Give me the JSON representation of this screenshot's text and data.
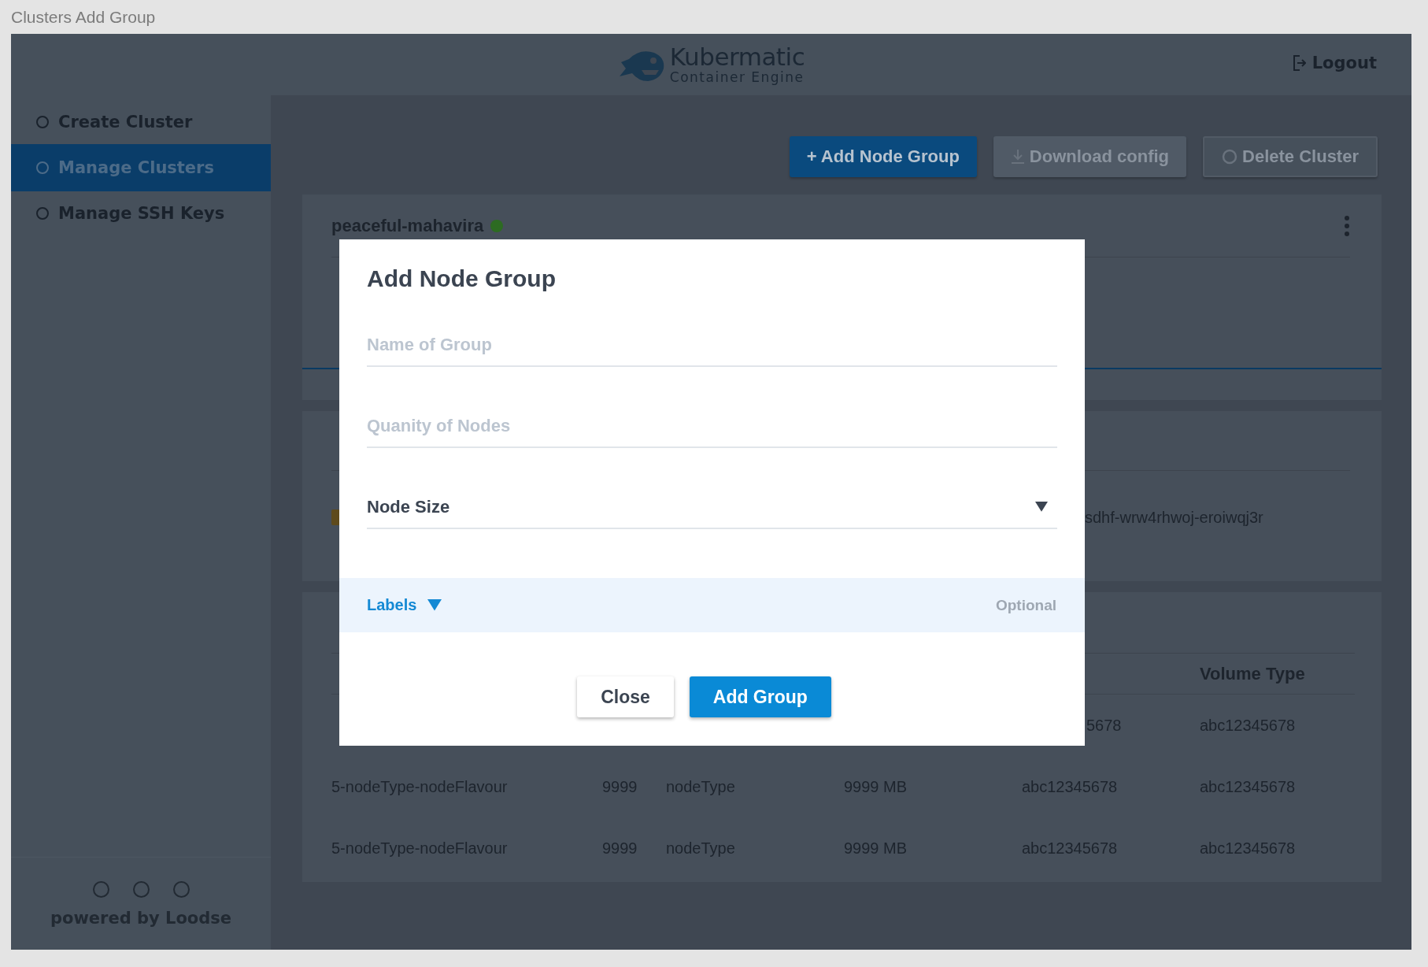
{
  "page_title": "Clusters Add Group",
  "header": {
    "logo_name": "Kubermatic",
    "logo_subtitle": "Container Engine",
    "logout": "Logout"
  },
  "sidebar": {
    "items": [
      {
        "label": "Create Cluster",
        "selected": false
      },
      {
        "label": "Manage Clusters",
        "selected": true
      },
      {
        "label": "Manage SSH Keys",
        "selected": false
      }
    ],
    "footer": "powered by Loodse"
  },
  "toolbar": {
    "buttons": [
      {
        "label": "+ Add Node Group",
        "kind": "primary"
      },
      {
        "label": "Download config",
        "kind": "download"
      },
      {
        "label": "Delete Cluster",
        "kind": "delete"
      }
    ]
  },
  "cluster_card": {
    "name": "peaceful-mahavira"
  },
  "provider_card": {
    "value_column_2": "sdhf-wrw4rhwoj-eroiwqj3r"
  },
  "nodes_card": {
    "columns": {
      "column_6": "Volume Type"
    },
    "rows": [
      {
        "partial": true,
        "column_5": "5678",
        "column_6": "abc12345678"
      },
      {
        "partial": false,
        "column_1": "5-nodeType-nodeFlavour",
        "column_2": "9999",
        "column_3": "nodeType",
        "column_4": "9999 MB",
        "column_5": "abc12345678",
        "column_6": "abc12345678"
      },
      {
        "partial": false,
        "column_1": "5-nodeType-nodeFlavour",
        "column_2": "9999",
        "column_3": "nodeType",
        "column_4": "9999 MB",
        "column_5": "abc12345678",
        "column_6": "abc12345678"
      }
    ]
  },
  "modal": {
    "title": "Add Node Group",
    "fields": [
      {
        "kind": "text",
        "placeholder": "Name of Group"
      },
      {
        "kind": "text",
        "placeholder": "Quanity of Nodes"
      },
      {
        "kind": "select",
        "label": "Node Size"
      }
    ],
    "labels_section": {
      "title": "Labels",
      "note": "Optional"
    },
    "buttons": [
      {
        "label": "Close",
        "kind": "secondary"
      },
      {
        "label": "Add Group",
        "kind": "primary"
      }
    ]
  }
}
